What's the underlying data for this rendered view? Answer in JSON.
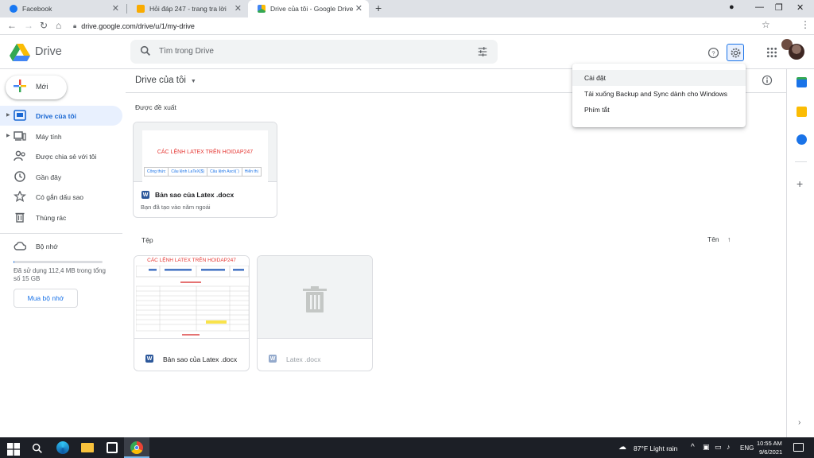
{
  "browser": {
    "tabs": [
      {
        "title": "Facebook",
        "active": false
      },
      {
        "title": "Hỏi đáp 247 - trang tra lời",
        "active": false
      },
      {
        "title": "Drive của tôi - Google Drive",
        "active": true
      }
    ],
    "url": "drive.google.com/drive/u/1/my-drive"
  },
  "app": {
    "brand": "Drive",
    "search_placeholder": "Tìm trong Drive"
  },
  "sidebar": {
    "new_label": "Mới",
    "items": [
      {
        "label": "Drive của tôi",
        "icon": "my-drive-icon",
        "active": true
      },
      {
        "label": "Máy tính",
        "icon": "computer-icon",
        "active": false
      },
      {
        "label": "Được chia sẻ với tôi",
        "icon": "shared-icon",
        "active": false
      },
      {
        "label": "Gần đây",
        "icon": "clock-icon",
        "active": false
      },
      {
        "label": "Có gắn dấu sao",
        "icon": "star-icon",
        "active": false
      },
      {
        "label": "Thùng rác",
        "icon": "trash-icon",
        "active": false
      }
    ],
    "storage_label": "Bộ nhớ",
    "storage_text": "Đã sử dụng 112,4 MB trong tổng số 15 GB",
    "storage_fraction": 0.007,
    "buy_label": "Mua bộ nhớ"
  },
  "main": {
    "title": "Drive của tôi",
    "suggested_label": "Được đề xuất",
    "suggested_card": {
      "doc_title": "CÁC LỆNH LATEX TRÊN HOIDAP247",
      "headers": [
        "Công thức",
        "Câu lệnh LaTeX($)",
        "Câu lệnh Ascii(`)",
        "Hiển thị"
      ],
      "name": "Bản sao của Latex .docx",
      "sub": "Bạn đã tạo vào năm ngoái"
    },
    "files_label": "Tệp",
    "sort_label": "Tên",
    "files": [
      {
        "name": "Bản sao của Latex .docx",
        "doc_title": "CÁC LỆNH LATEX TRÊN HOIDAP247"
      },
      {
        "name": "Latex .docx"
      }
    ]
  },
  "settings_menu": {
    "items": [
      "Cài đặt",
      "Tải xuống Backup and Sync dành cho Windows",
      "Phím tắt"
    ]
  },
  "taskbar": {
    "weather": "87°F  Light rain",
    "lang": "ENG",
    "time": "10:55 AM",
    "date": "9/6/2021"
  },
  "colors": {
    "accent": "#1a73e8",
    "active_bg": "#e8f0fe"
  }
}
